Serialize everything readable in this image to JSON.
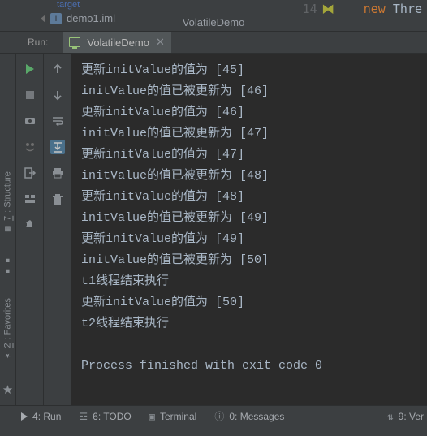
{
  "top": {
    "target_folder": "target",
    "file_name": "demo1.iml",
    "editor_tab": "VolatileDemo",
    "line_no": "14",
    "code_kw": "new",
    "code_rest": " Thre"
  },
  "run_header": {
    "label": "Run:",
    "tab_name": "VolatileDemo"
  },
  "side_tabs": {
    "structure_key": "7",
    "structure": ": Structure",
    "favorites_key": "2",
    "favorites": ": Favorites"
  },
  "console_lines": [
    "更新initValue的值为 [45]",
    "initValue的值已被更新为 [46]",
    "更新initValue的值为 [46]",
    "initValue的值已被更新为 [47]",
    "更新initValue的值为 [47]",
    "initValue的值已被更新为 [48]",
    "更新initValue的值为 [48]",
    "initValue的值已被更新为 [49]",
    "更新initValue的值为 [49]",
    "initValue的值已被更新为 [50]",
    "t1线程结束执行",
    "更新initValue的值为 [50]",
    "t2线程结束执行",
    "",
    "Process finished with exit code 0"
  ],
  "bottom": {
    "run_key": "4",
    "run": ": Run",
    "todo_key": "6",
    "todo": ": TODO",
    "terminal": "Terminal",
    "messages_key": "0",
    "messages": ": Messages",
    "ver_key": "9",
    "ver": ": Ver"
  },
  "status": ""
}
